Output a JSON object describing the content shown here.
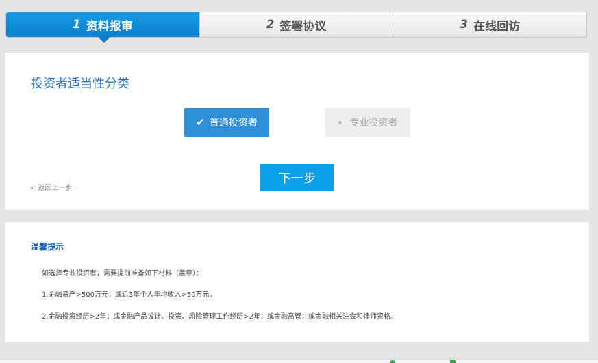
{
  "stepper": {
    "steps": [
      {
        "num": "1",
        "label": "资料报审"
      },
      {
        "num": "2",
        "label": "签署协议"
      },
      {
        "num": "3",
        "label": "在线回访"
      }
    ],
    "active_index": 0
  },
  "classification": {
    "title": "投资者适当性分类",
    "options": [
      {
        "label": "普通投资者",
        "selected": true
      },
      {
        "label": "专业投资者",
        "selected": false
      }
    ],
    "back_link": "< 返回上一步",
    "next_button": "下一步"
  },
  "tips": {
    "title": "温馨提示",
    "lines": [
      "如选择专业投资者，需要提前准备如下材料（盖章）：",
      "1.金融资产>500万元；或近3年个人年均收入>50万元。",
      "2.金融投资经历>2年；或金融产品设计、投资、风险管理工作经历>2年；或金融高管；或金融相关注会和律师资格。"
    ]
  },
  "colors": {
    "accent": "#0ba0e8",
    "active_step": "#1a9be6",
    "title_blue": "#2c6fb6"
  }
}
